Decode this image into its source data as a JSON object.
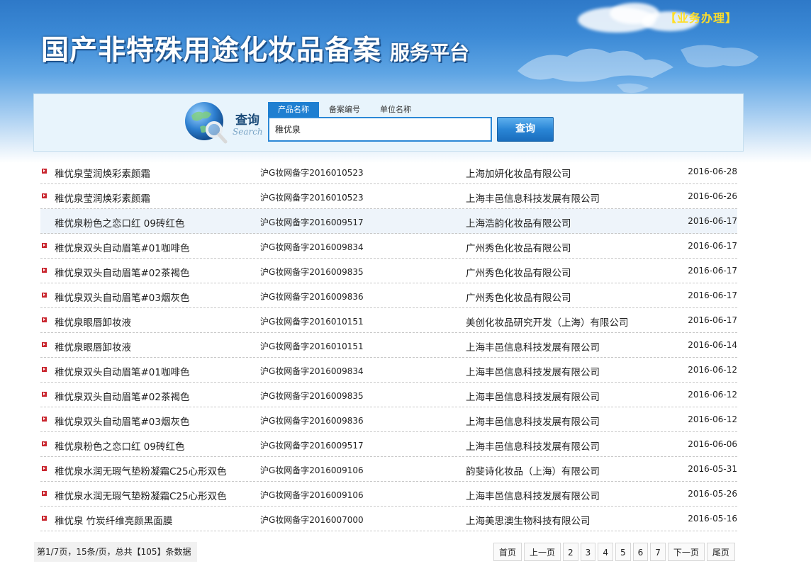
{
  "header": {
    "title_main": "国产非特殊用途化妆品备案",
    "title_sub": "服务平台",
    "business_link": "【业务办理】"
  },
  "search": {
    "label": "查询",
    "label_en": "Search",
    "tabs": [
      "产品名称",
      "备案编号",
      "单位名称"
    ],
    "active_tab": 0,
    "query": "稚优泉",
    "button": "查询"
  },
  "records": [
    {
      "name": "稚优泉莹润焕彩素颜霜",
      "code": "沪G妆网备字2016010523",
      "company": "上海加妍化妆品有限公司",
      "date": "2016-06-28"
    },
    {
      "name": "稚优泉莹润焕彩素颜霜",
      "code": "沪G妆网备字2016010523",
      "company": "上海丰邑信息科技发展有限公司",
      "date": "2016-06-26"
    },
    {
      "name": "稚优泉粉色之恋口红 09砖红色",
      "code": "沪G妆网备字2016009517",
      "company": "上海浩韵化妆品有限公司",
      "date": "2016-06-17"
    },
    {
      "name": "稚优泉双头自动眉笔#01咖啡色",
      "code": "沪G妆网备字2016009834",
      "company": "广州秀色化妆品有限公司",
      "date": "2016-06-17"
    },
    {
      "name": "稚优泉双头自动眉笔#02茶褐色",
      "code": "沪G妆网备字2016009835",
      "company": "广州秀色化妆品有限公司",
      "date": "2016-06-17"
    },
    {
      "name": "稚优泉双头自动眉笔#03烟灰色",
      "code": "沪G妆网备字2016009836",
      "company": "广州秀色化妆品有限公司",
      "date": "2016-06-17"
    },
    {
      "name": "稚优泉眼唇卸妆液",
      "code": "沪G妆网备字2016010151",
      "company": "美创化妆品研究开发（上海）有限公司",
      "date": "2016-06-17"
    },
    {
      "name": "稚优泉眼唇卸妆液",
      "code": "沪G妆网备字2016010151",
      "company": "上海丰邑信息科技发展有限公司",
      "date": "2016-06-14"
    },
    {
      "name": "稚优泉双头自动眉笔#01咖啡色",
      "code": "沪G妆网备字2016009834",
      "company": "上海丰邑信息科技发展有限公司",
      "date": "2016-06-12"
    },
    {
      "name": "稚优泉双头自动眉笔#02茶褐色",
      "code": "沪G妆网备字2016009835",
      "company": "上海丰邑信息科技发展有限公司",
      "date": "2016-06-12"
    },
    {
      "name": "稚优泉双头自动眉笔#03烟灰色",
      "code": "沪G妆网备字2016009836",
      "company": "上海丰邑信息科技发展有限公司",
      "date": "2016-06-12"
    },
    {
      "name": "稚优泉粉色之恋口红 09砖红色",
      "code": "沪G妆网备字2016009517",
      "company": "上海丰邑信息科技发展有限公司",
      "date": "2016-06-06"
    },
    {
      "name": "稚优泉水润无瑕气垫粉凝霜C25心形双色",
      "code": "沪G妆网备字2016009106",
      "company": "韵斐诗化妆品（上海）有限公司",
      "date": "2016-05-31"
    },
    {
      "name": "稚优泉水润无瑕气垫粉凝霜C25心形双色",
      "code": "沪G妆网备字2016009106",
      "company": "上海丰邑信息科技发展有限公司",
      "date": "2016-05-26"
    },
    {
      "name": "稚优泉 竹炭纤维亮颜黑面膜",
      "code": "沪G妆网备字2016007000",
      "company": "上海美思澳生物科技有限公司",
      "date": "2016-05-16"
    }
  ],
  "pagination": {
    "info": "第1/7页，15条/页，总共【105】条数据",
    "first": "首页",
    "prev": "上一页",
    "pages": [
      "2",
      "3",
      "4",
      "5",
      "6",
      "7"
    ],
    "next": "下一页",
    "last": "尾页"
  },
  "colors": {
    "accent": "#1f7fd1",
    "bullet": "#c9262f",
    "business_link": "#ffde28"
  }
}
